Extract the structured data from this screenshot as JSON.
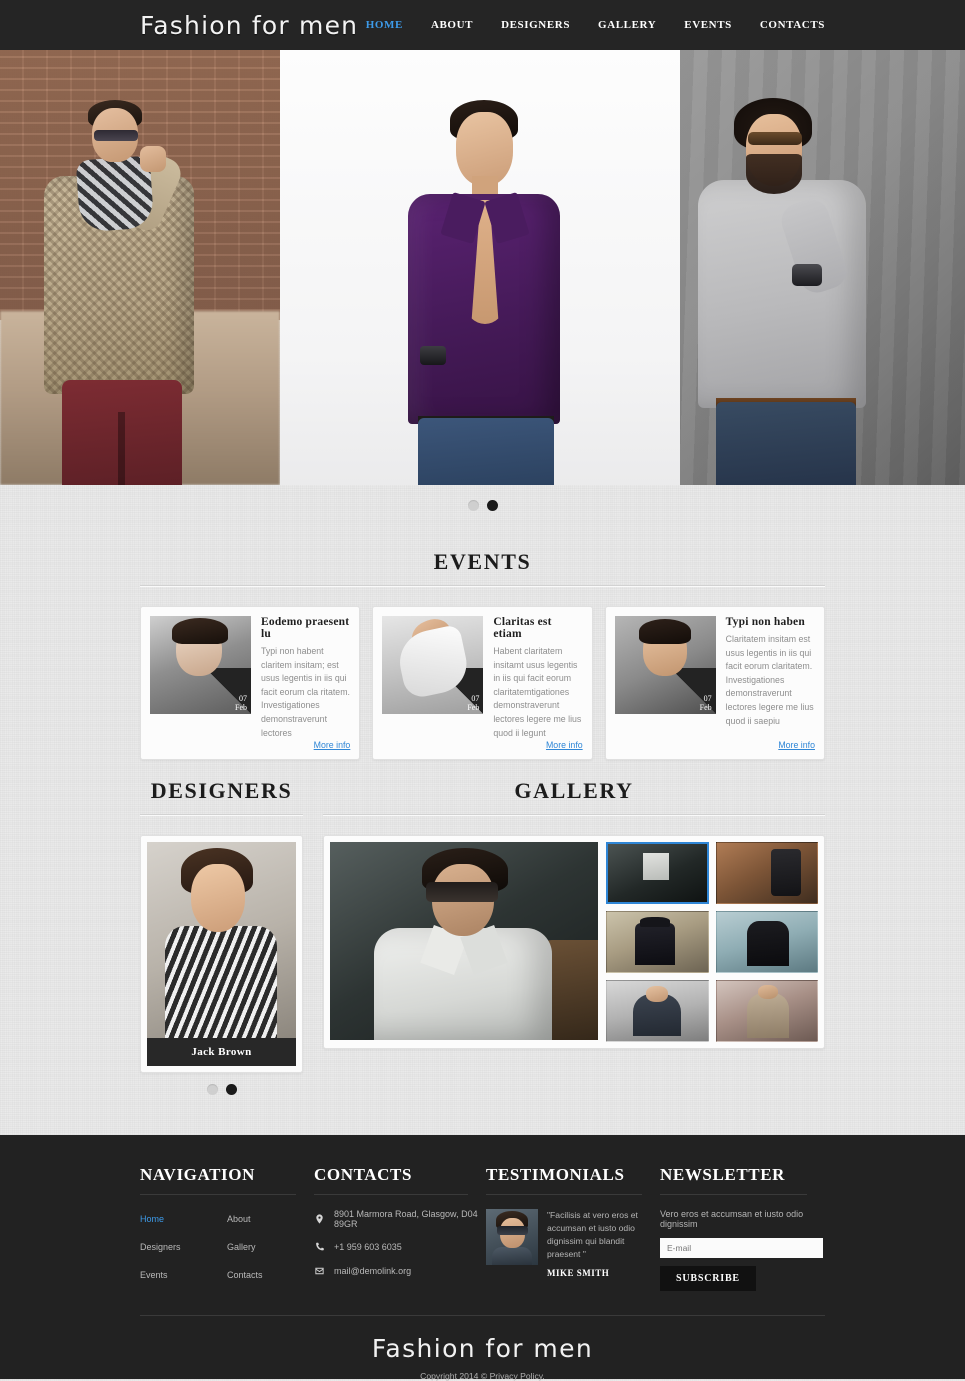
{
  "site": {
    "logo": "Fashion for men",
    "accent_color": "#3d9ae8",
    "header_bg": "#252525",
    "footer_bg": "#222222",
    "body_bg": "#e9e9e9"
  },
  "nav": {
    "items": [
      {
        "label": "HOME",
        "active": true
      },
      {
        "label": "ABOUT",
        "active": false
      },
      {
        "label": "DESIGNERS",
        "active": false
      },
      {
        "label": "GALLERY",
        "active": false
      },
      {
        "label": "EVENTS",
        "active": false
      },
      {
        "label": "CONTACTS",
        "active": false
      }
    ]
  },
  "slider": {
    "dots": [
      "inactive",
      "active"
    ]
  },
  "events": {
    "title": "EVENTS",
    "cards": [
      {
        "title": "Eodemo praesent lu",
        "text": "Typi non habent claritem insitam; est usus legentis in iis qui facit eorum cla ritatem. Investigationes demonstraverunt lectores",
        "day": "07",
        "month": "Feb",
        "more": "More info"
      },
      {
        "title": "Claritas est etiam",
        "text": "Habent claritatem insitamt usus legentis in iis qui facit eorum claritatemtigationes demonstraverunt lectores legere me lius quod ii legunt",
        "day": "07",
        "month": "Feb",
        "more": "More info"
      },
      {
        "title": "Typi non haben",
        "text": "Claritatem insitam est usus legentis in iis qui facit eorum claritatem. Investigationes demonstraverunt lectores legere me lius quod ii saepiu",
        "day": "07",
        "month": "Feb",
        "more": "More info"
      }
    ]
  },
  "designers": {
    "title": "DESIGNERS",
    "name": "Jack Brown",
    "dots": [
      "inactive",
      "active"
    ]
  },
  "gallery": {
    "title": "GALLERY",
    "thumbs": [
      {
        "selected": true
      },
      {
        "selected": false
      },
      {
        "selected": false
      },
      {
        "selected": false
      },
      {
        "selected": false
      },
      {
        "selected": false
      }
    ]
  },
  "footer": {
    "navigation": {
      "title": "NAVIGATION",
      "col1": [
        {
          "label": "Home",
          "active": true
        },
        {
          "label": "Designers",
          "active": false
        },
        {
          "label": "Events",
          "active": false
        }
      ],
      "col2": [
        {
          "label": "About",
          "active": false
        },
        {
          "label": "Gallery",
          "active": false
        },
        {
          "label": "Contacts",
          "active": false
        }
      ]
    },
    "contacts": {
      "title": "CONTACTS",
      "address": "8901 Marmora Road, Glasgow, D04 89GR",
      "phone": "+1 959 603 6035",
      "email": "mail@demolink.org"
    },
    "testimonials": {
      "title": "TESTIMONIALS",
      "quote": "\"Facilisis at vero eros et accumsan et iusto odio dignissim qui blandit praesent \"",
      "author": "MIKE SMITH"
    },
    "newsletter": {
      "title": "NEWSLETTER",
      "text": "Vero eros et accumsan et iusto odio dignissim",
      "input_placeholder": "E-mail",
      "input_value": "",
      "button": "SUBSCRIBE"
    },
    "bottom": {
      "logo": "Fashion for men",
      "copyright_prefix": "Copyright 2014 © ",
      "privacy_link": "Privacy Policy."
    }
  }
}
